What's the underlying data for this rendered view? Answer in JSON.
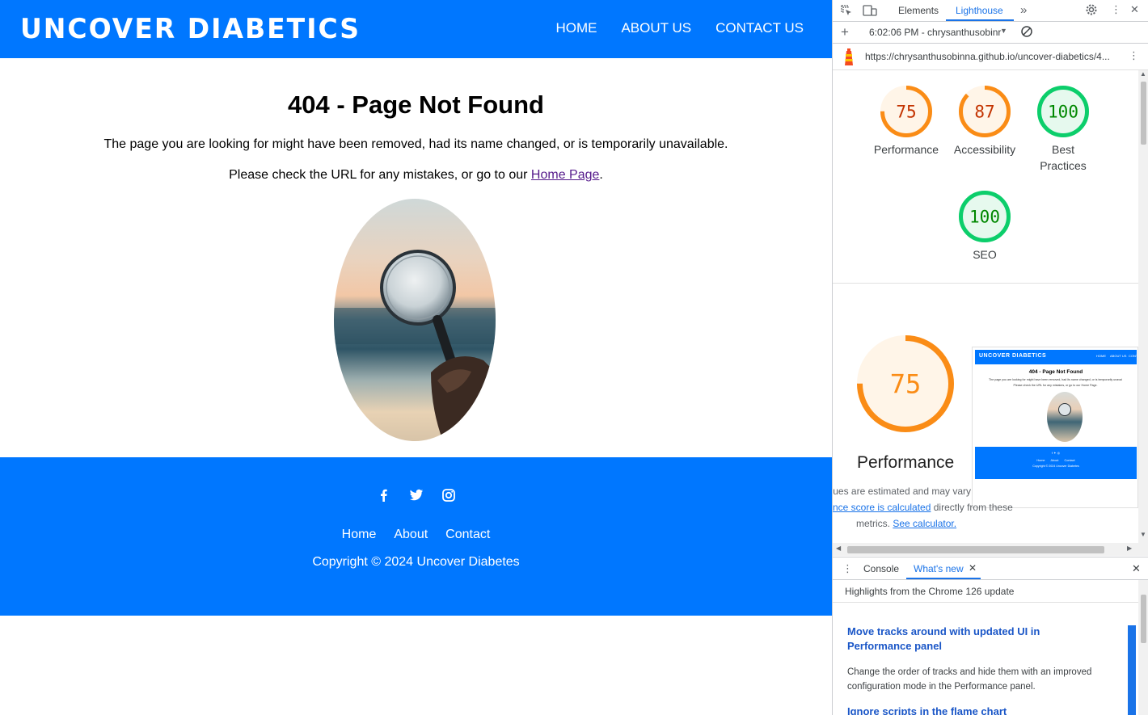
{
  "site": {
    "logo": "UNCOVER DIABETICS",
    "nav": [
      "HOME",
      "ABOUT US",
      "CONTACT US"
    ],
    "title": "404 - Page Not Found",
    "message1": "The page you are looking for might have been removed, had its name changed, or is temporarily unavailable.",
    "message2_prefix": "Please check the URL for any mistakes, or go to our ",
    "message2_link": "Home Page",
    "message2_suffix": ".",
    "footer_links": [
      "Home",
      "About",
      "Contact"
    ],
    "copyright": "Copyright © 2024 Uncover Diabetes",
    "social_icons": [
      "facebook-icon",
      "twitter-icon",
      "instagram-icon"
    ],
    "brand_color": "#0077ff"
  },
  "devtools": {
    "tabs": [
      "Elements",
      "Lighthouse"
    ],
    "active_tab": "Lighthouse",
    "report_time": "6:02:06 PM - chrysanthusobinr",
    "url": "https://chrysanthusobinna.github.io/uncover-diabetics/4...",
    "scores": [
      {
        "label": "Performance",
        "value": 75,
        "color": "#fa8c16",
        "fill": "#fff5e8"
      },
      {
        "label": "Accessibility",
        "value": 87,
        "color": "#fa8c16",
        "fill": "#fff5e8"
      },
      {
        "label": "Best Practices",
        "value": 100,
        "color": "#0cce6b",
        "fill": "#e6f9ee"
      },
      {
        "label": "SEO",
        "value": 100,
        "color": "#0cce6b",
        "fill": "#e6f9ee"
      }
    ],
    "performance_big": {
      "label": "Performance",
      "value": 75
    },
    "note_line1": "ues are estimated and may vary",
    "note_line2_link": "nce score is calculated",
    "note_line2_rest": " directly from these",
    "note_line3_prefix": "metrics. ",
    "note_line3_link": "See calculator.",
    "drawer": {
      "tabs": [
        "Console",
        "What's new"
      ],
      "active_tab": "What's new",
      "subtitle": "Highlights from the Chrome 126 update",
      "items": [
        {
          "title": "Move tracks around with updated UI in Performance panel",
          "desc": "Change the order of tracks and hide them with an improved configuration mode in the Performance panel."
        },
        {
          "title": "Ignore scripts in the flame chart",
          "desc": ""
        }
      ]
    },
    "thumbnail": {
      "logo": "UNCOVER DIABETICS",
      "nav": [
        "HOME",
        "ABOUT US",
        "CONT"
      ],
      "title": "404 - Page Not Found",
      "line1": "The page you are looking for might have been removed, had its name changed, or is temporarily unavailable.",
      "line2": "Please check the URL for any mistakes, or go to our Home Page.",
      "footer_links": [
        "Home",
        "About",
        "Contact"
      ],
      "copyright": "Copyright © 2024 Uncover Diabetes"
    }
  }
}
